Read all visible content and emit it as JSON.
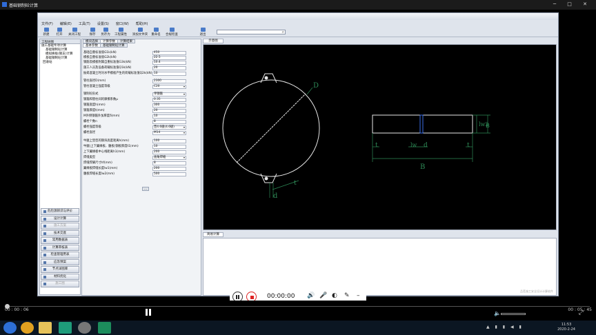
{
  "window": {
    "title": "基础钢制砼计算"
  },
  "menu": [
    "文件(F)",
    "编辑(E)",
    "工具(T)",
    "设置(S)",
    "窗口(W)",
    "帮助(H)"
  ],
  "toolbar": [
    "新建",
    "打开",
    "关闭工程",
    "保存",
    "另存为",
    "工程属性",
    "添加文件夹",
    "重命名",
    "合规检查",
    "退出"
  ],
  "left": {
    "header": "工程树图",
    "tree": [
      "施工基础专项计算",
      "基础钢制砼计算",
      "模拟换板(钢支)计算",
      "基础钢制砼计算",
      "回收站"
    ],
    "nav": [
      {
        "label": "危险源辨识与评价",
        "dis": false
      },
      {
        "label": "设计计算",
        "dis": false
      },
      {
        "label": "施工方案",
        "dis": true
      },
      {
        "label": "技术交底",
        "dis": false
      },
      {
        "label": "常用数据表",
        "dis": false
      },
      {
        "label": "计算审核表",
        "dis": false
      },
      {
        "label": "检查管理用表",
        "dis": false
      },
      {
        "label": "应急预案",
        "dis": false
      },
      {
        "label": "节点详图库",
        "dis": false
      },
      {
        "label": "材料优化",
        "dis": false
      },
      {
        "label": "施工图",
        "dis": true
      }
    ]
  },
  "calc": {
    "tabs": [
      "模块选择",
      "计算参数",
      "计算结果"
    ],
    "subtabs": [
      "基本参数",
      "基础钢制砼计算"
    ],
    "rows": [
      {
        "label": "基础自重标准值G1k(kN)",
        "value": "450"
      },
      {
        "label": "模板自重标准值G2k(kN)",
        "value": "22.5"
      },
      {
        "label": "钢筋及模板附属自重标准值G3k(kN)",
        "value": "10.4"
      },
      {
        "label": "施工人员及设备荷载标准值Q1k(kN)",
        "value": "20"
      },
      {
        "label": "振捣混凝土时对水平模板产生的荷载标准值Q2k(kN)",
        "value": "10"
      },
      {
        "label": "管柱直径D(mm)",
        "value": "2300"
      },
      {
        "label": "管柱混凝土强度等级",
        "value": "C20",
        "sel": true
      },
      {
        "label": "钢制砼形式",
        "value": "单钢箍",
        "sel": true
      },
      {
        "label": "钢箍和管柱间的摩擦系数μ",
        "value": "0.35"
      },
      {
        "label": "钢箍宽度h(mm)",
        "value": "300"
      },
      {
        "label": "钢箍厚度t(mm)",
        "value": "20"
      },
      {
        "label": "M外侧钢箍外加厚度δ(mm)",
        "value": "10"
      },
      {
        "label": "螺栓个数n",
        "value": "8"
      },
      {
        "label": "螺栓强度等级",
        "value": "普4.6级(4.6级)",
        "sel": true
      },
      {
        "label": "螺栓直径",
        "value": "M14",
        "sel": true
      },
      {
        "label": "牛腿上垫型的钢块高度距离h(mm)",
        "value": "100"
      },
      {
        "label": "牛腿(上下翼缘板、腹板)钢板厚度t1(mm)",
        "value": "10"
      },
      {
        "label": "上下翼缘板中心线距离h1(mm)",
        "value": "200"
      },
      {
        "label": "焊缝类型",
        "value": "直角焊缝",
        "sel": true
      },
      {
        "label": "焊缝焊脚尺寸hf(mm)",
        "value": "8"
      },
      {
        "label": "翼缘板焊缝长度lw1(mm)",
        "value": "200"
      },
      {
        "label": "腹板焊缝长度lw2(mm)",
        "value": "500"
      }
    ]
  },
  "viewer": {
    "tab": "示意图",
    "labels": {
      "D": "D",
      "t": "t",
      "d": "d",
      "lw": "lw",
      "lw2": "lw2",
      "B": "B"
    }
  },
  "lower": {
    "tab": "简易计算",
    "status": "品茗施工安全设计计算软件"
  },
  "recorder": {
    "time": "00:00:00"
  },
  "player": {
    "elapsed": "00 : 00 : 06",
    "total": "00 : 05 : 45"
  },
  "taskbar": {
    "time": "11:53",
    "date": "2020-2-24"
  }
}
